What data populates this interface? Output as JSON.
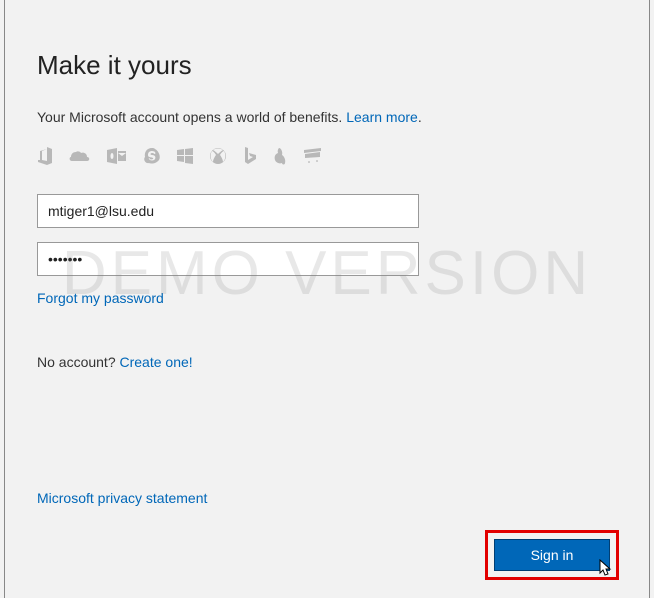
{
  "title": "Make it yours",
  "subtitle_text": "Your Microsoft account opens a world of benefits. ",
  "learn_more": "Learn more",
  "period": ".",
  "email_value": "mtiger1@lsu.edu",
  "password_value": "•••••••",
  "forgot_label": "Forgot my password",
  "noaccount_text": "No account? ",
  "create_one": "Create one!",
  "privacy_label": "Microsoft privacy statement",
  "signin_label": "Sign in",
  "watermark": "DEMO VERSION"
}
